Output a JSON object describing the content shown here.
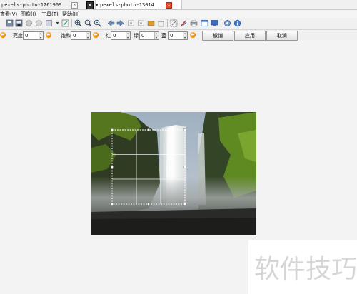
{
  "tabs": [
    {
      "title": "pexels-photo-1261909...",
      "active": false
    },
    {
      "title": "pexels-photo-13014...",
      "active": true
    }
  ],
  "menu": [
    "查看(V)",
    "图像(I)",
    "工具(T)",
    "帮助(H)"
  ],
  "toolbar": {
    "icons": [
      "open-icon",
      "save-icon",
      "scan-icon",
      "copy-icon",
      "paste-icon",
      "dropdown-icon",
      "edit-icon",
      "zoom-in-icon",
      "zoom-fit-icon",
      "zoom-out-icon",
      "previous-icon",
      "next-icon",
      "rotate-left-icon",
      "rotate-right-icon",
      "folder-icon",
      "delete-icon",
      "resize-icon",
      "paint-icon",
      "print-icon",
      "window-icon",
      "monitor-icon",
      "settings-icon",
      "info-icon"
    ]
  },
  "adjust": {
    "brightness": {
      "label": "亮度",
      "value": "0"
    },
    "saturation": {
      "label": "饱和",
      "value": "0"
    },
    "red": {
      "label": "红",
      "value": "0"
    },
    "green": {
      "label": "绿",
      "value": "0"
    },
    "blue": {
      "label": "蓝",
      "value": "0"
    },
    "undo_label": "撤销",
    "apply_label": "应用",
    "cancel_label": "取消"
  },
  "watermark": "软件技巧",
  "colors": {
    "accent_orange": "#f08a00",
    "close_red": "#e24b2b",
    "selection": "#ffffff"
  }
}
